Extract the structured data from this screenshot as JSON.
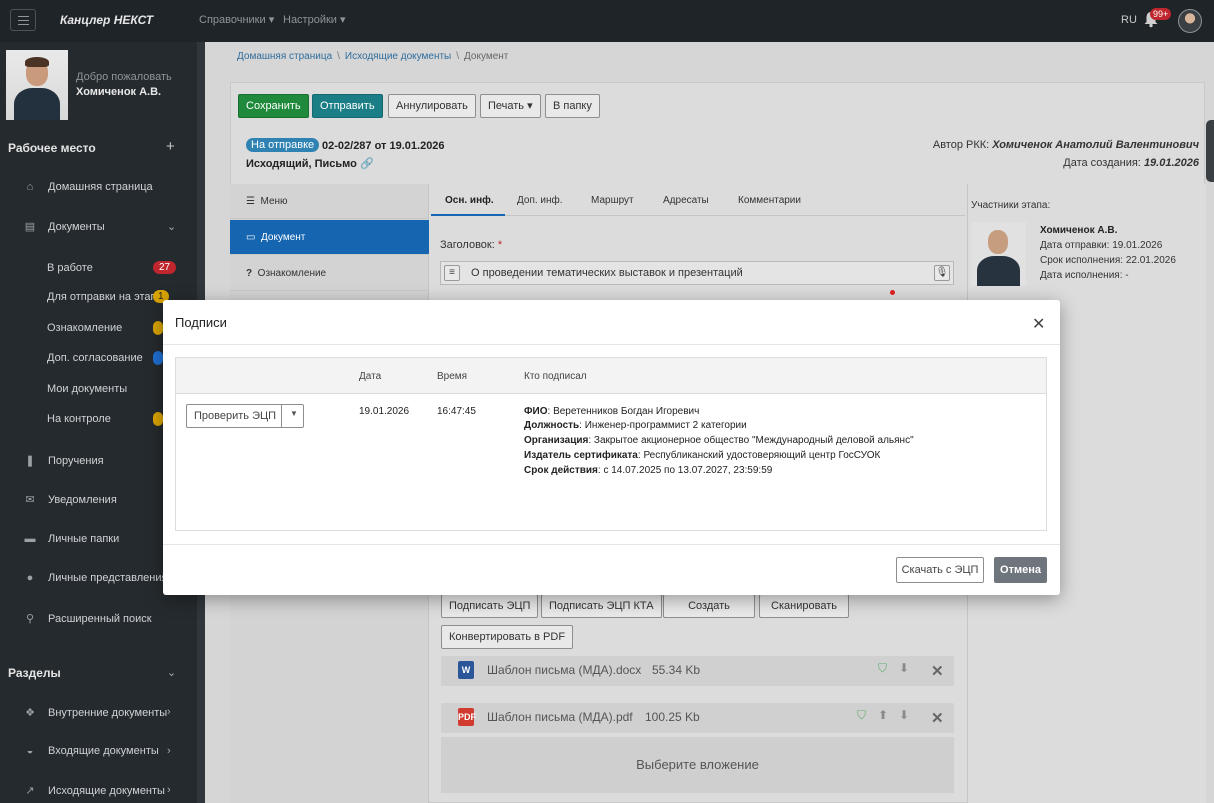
{
  "topbar": {
    "app_title": "Канцлер НЕКСТ",
    "menu": [
      "Справочники",
      "Настройки"
    ],
    "lang": "RU",
    "notif_count": "99+"
  },
  "sidebar": {
    "welcome": "Добро пожаловать",
    "user_name": "Хомиченок А.В.",
    "workspace_title": "Рабочее место",
    "items": [
      {
        "label": "Домашняя страница",
        "icon": "home-icon"
      },
      {
        "label": "Документы",
        "icon": "document-icon"
      }
    ],
    "doc_sub": [
      {
        "label": "В работе",
        "badge": "27",
        "badge_color": "#c0262d"
      },
      {
        "label": "Для отправки на этап",
        "badge": "1",
        "badge_color": "#d9a400"
      },
      {
        "label": "Ознакомление",
        "badge": "",
        "badge_color": "#d9a400"
      },
      {
        "label": "Доп. согласование",
        "badge": "",
        "badge_color": "#1f6fd1"
      },
      {
        "label": "Мои документы",
        "badge": "",
        "badge_color": ""
      },
      {
        "label": "На контроле",
        "badge": "",
        "badge_color": "#d9a400"
      }
    ],
    "more_items": [
      {
        "label": "Поручения",
        "icon": "bookmark-icon"
      },
      {
        "label": "Уведомления",
        "icon": "envelope-icon"
      },
      {
        "label": "Личные папки",
        "icon": "folder-icon"
      },
      {
        "label": "Личные представления",
        "icon": "user-icon"
      },
      {
        "label": "Расширенный поиск",
        "icon": "search-icon"
      }
    ],
    "sections_title": "Разделы",
    "sections": [
      {
        "label": "Внутренние документы",
        "icon": "cubes-icon"
      },
      {
        "label": "Входящие документы",
        "icon": "inbox-icon"
      },
      {
        "label": "Исходящие документы",
        "icon": "external-icon"
      }
    ]
  },
  "breadcrumb": [
    "Домашняя страница",
    "Исходящие документы",
    "Документ"
  ],
  "toolbar": {
    "save": "Сохранить",
    "send": "Отправить",
    "cancel_doc": "Аннулировать",
    "print": "Печать",
    "to_folder": "В папку"
  },
  "document": {
    "status": "На отправке",
    "number": "02-02/287 от 19.01.2026",
    "type": "Исходящий, Письмо",
    "author_label": "Автор РКК:",
    "author": "Хомиченок Анатолий Валентинович",
    "created_label": "Дата создания:",
    "created": "19.01.2026"
  },
  "leftnav": [
    "Меню",
    "Документ",
    "Ознакомление"
  ],
  "tabs": [
    "Осн. инф.",
    "Доп. инф.",
    "Маршрут",
    "Адресаты",
    "Комментарии"
  ],
  "form": {
    "title_label": "Заголовок:",
    "required_mark": "*",
    "title_value": "О проведении тематических выставок и презентаций"
  },
  "participants": {
    "title": "Участники этапа:",
    "name": "Хомиченок А.В.",
    "lines": [
      "Дата отправки: 19.01.2026",
      "Срок исполнения: 22.01.2026",
      "Дата исполнения: -"
    ]
  },
  "actions": {
    "sign": "Подписать ЭЦП",
    "sign_kta": "Подписать ЭЦП КТА",
    "create": "Создать",
    "scan": "Сканировать",
    "convert": "Конвертировать в PDF"
  },
  "attachments": [
    {
      "name": "Шаблон письма (МДА).docx",
      "size": "55.34 Kb",
      "icon": "word-file-icon",
      "color": "#2b579a"
    },
    {
      "name": "Шаблон письма (МДА).pdf",
      "size": "100.25 Kb",
      "icon": "pdf-file-icon",
      "color": "#d13a2f"
    }
  ],
  "select_attachment": "Выберите вложение",
  "modal": {
    "title": "Подписи",
    "columns": [
      "Дата",
      "Время",
      "Кто подписал"
    ],
    "verify_label": "Проверить ЭЦП",
    "row": {
      "date": "19.01.2026",
      "time": "16:47:45",
      "fields": [
        {
          "k": "ФИО",
          "v": "Веретенников Богдан Игоревич"
        },
        {
          "k": "Должность",
          "v": "Инженер-программист 2 категории"
        },
        {
          "k": "Организация",
          "v": "Закрытое акционерное общество \"Международный деловой альянс\""
        },
        {
          "k": "Издатель сертификата",
          "v": "Республиканский удостоверяющий центр ГосСУОК"
        },
        {
          "k": "Срок действия",
          "v": "с 14.07.2025 по 13.07.2027, 23:59:59"
        }
      ]
    },
    "download_label": "Скачать с ЭЦП",
    "cancel_label": "Отмена"
  },
  "colors": {
    "topbar": "#1f2429",
    "sidebar": "#252a2e",
    "primary": "#1565b0",
    "save_green": "#1f8a3b",
    "send_teal": "#1b7e86",
    "badge_red": "#c0262d"
  }
}
